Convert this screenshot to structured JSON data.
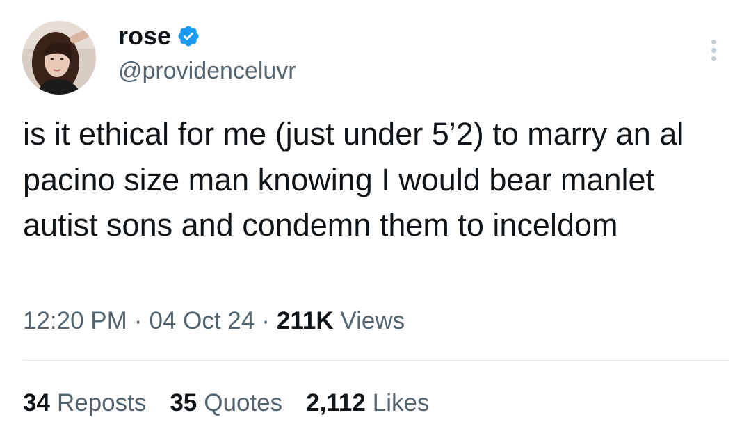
{
  "author": {
    "display_name": "rose",
    "handle": "@providenceluvr",
    "verified": true
  },
  "tweet": {
    "text": "is it ethical for me (just under 5’2) to marry an al pacino size man knowing I would bear manlet autist sons and condemn them to inceldom",
    "time": "12:20 PM",
    "date": "04 Oct 24",
    "separator": "·",
    "views_count": "211K",
    "views_label": "Views"
  },
  "stats": {
    "reposts_count": "34",
    "reposts_label": "Reposts",
    "quotes_count": "35",
    "quotes_label": "Quotes",
    "likes_count": "2,112",
    "likes_label": "Likes"
  },
  "icons": {
    "verified": "verified-badge-icon",
    "more": "more-options-icon"
  },
  "colors": {
    "text_primary": "#0f1419",
    "text_secondary": "#536471",
    "verified_blue": "#1d9bf0",
    "divider": "#e6e9eb"
  }
}
